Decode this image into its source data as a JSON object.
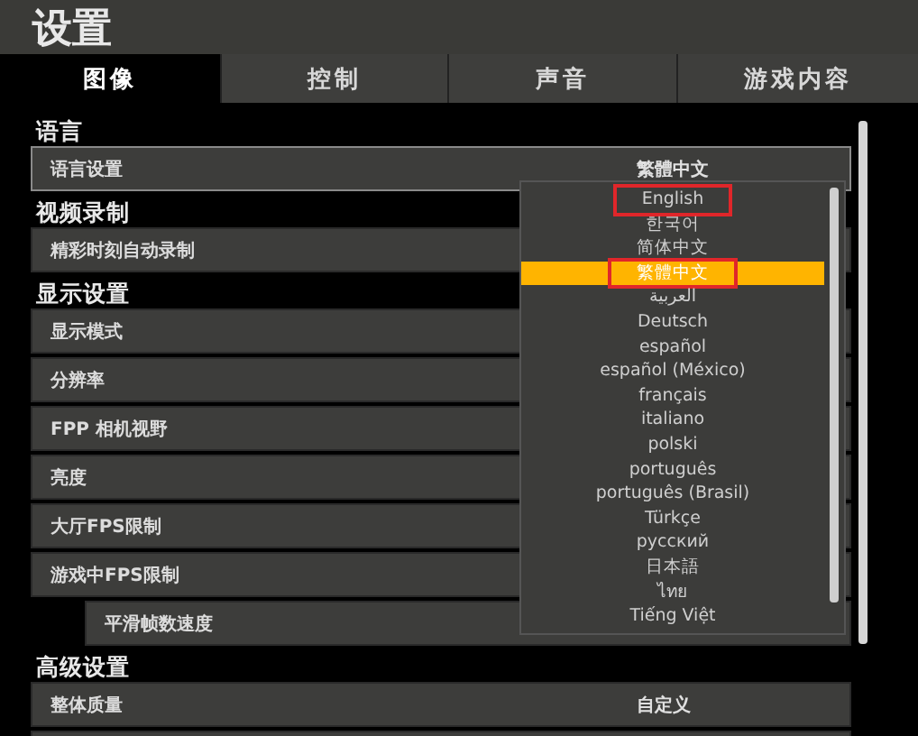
{
  "title": "设置",
  "tabs": [
    {
      "label": "图像",
      "selected": true
    },
    {
      "label": "控制",
      "selected": false
    },
    {
      "label": "声音",
      "selected": false
    },
    {
      "label": "游戏内容",
      "selected": false
    }
  ],
  "sections": [
    {
      "heading": "语言",
      "rows": [
        {
          "label": "语言设置",
          "value": "繁體中文",
          "indented": false,
          "focused": true
        }
      ]
    },
    {
      "heading": "视频录制",
      "rows": [
        {
          "label": "精彩时刻自动录制",
          "indented": false,
          "focused": false
        }
      ]
    },
    {
      "heading": "显示设置",
      "rows": [
        {
          "label": "显示模式",
          "indented": false,
          "focused": false
        },
        {
          "label": "分辨率",
          "indented": false,
          "focused": false
        },
        {
          "label": "FPP 相机视野",
          "indented": false,
          "focused": false
        },
        {
          "label": "亮度",
          "indented": false,
          "focused": false
        },
        {
          "label": "大厅FPS限制",
          "indented": false,
          "focused": false
        },
        {
          "label": "游戏中FPS限制",
          "indented": false,
          "focused": false
        },
        {
          "label": "平滑帧数速度",
          "indented": true,
          "focused": false
        }
      ]
    },
    {
      "heading": "高级设置",
      "rows": [
        {
          "label": "整体质量",
          "value": "自定义",
          "indented": false,
          "focused": false
        }
      ]
    }
  ],
  "dropdown": {
    "items": [
      {
        "label": "English",
        "selected": false,
        "marked": true
      },
      {
        "label": "한국어",
        "selected": false,
        "marked": false
      },
      {
        "label": "简体中文",
        "selected": false,
        "marked": false
      },
      {
        "label": "繁體中文",
        "selected": true,
        "marked": true
      },
      {
        "label": "العربية",
        "selected": false,
        "marked": false
      },
      {
        "label": "Deutsch",
        "selected": false,
        "marked": false
      },
      {
        "label": "español",
        "selected": false,
        "marked": false
      },
      {
        "label": "español (México)",
        "selected": false,
        "marked": false
      },
      {
        "label": "français",
        "selected": false,
        "marked": false
      },
      {
        "label": "italiano",
        "selected": false,
        "marked": false
      },
      {
        "label": "polski",
        "selected": false,
        "marked": false
      },
      {
        "label": "português",
        "selected": false,
        "marked": false
      },
      {
        "label": "português (Brasil)",
        "selected": false,
        "marked": false
      },
      {
        "label": "Türkçe",
        "selected": false,
        "marked": false
      },
      {
        "label": "русский",
        "selected": false,
        "marked": false
      },
      {
        "label": "日本語",
        "selected": false,
        "marked": false
      },
      {
        "label": "ไทย",
        "selected": false,
        "marked": false
      },
      {
        "label": "Tiếng Việt",
        "selected": false,
        "marked": false
      }
    ]
  }
}
